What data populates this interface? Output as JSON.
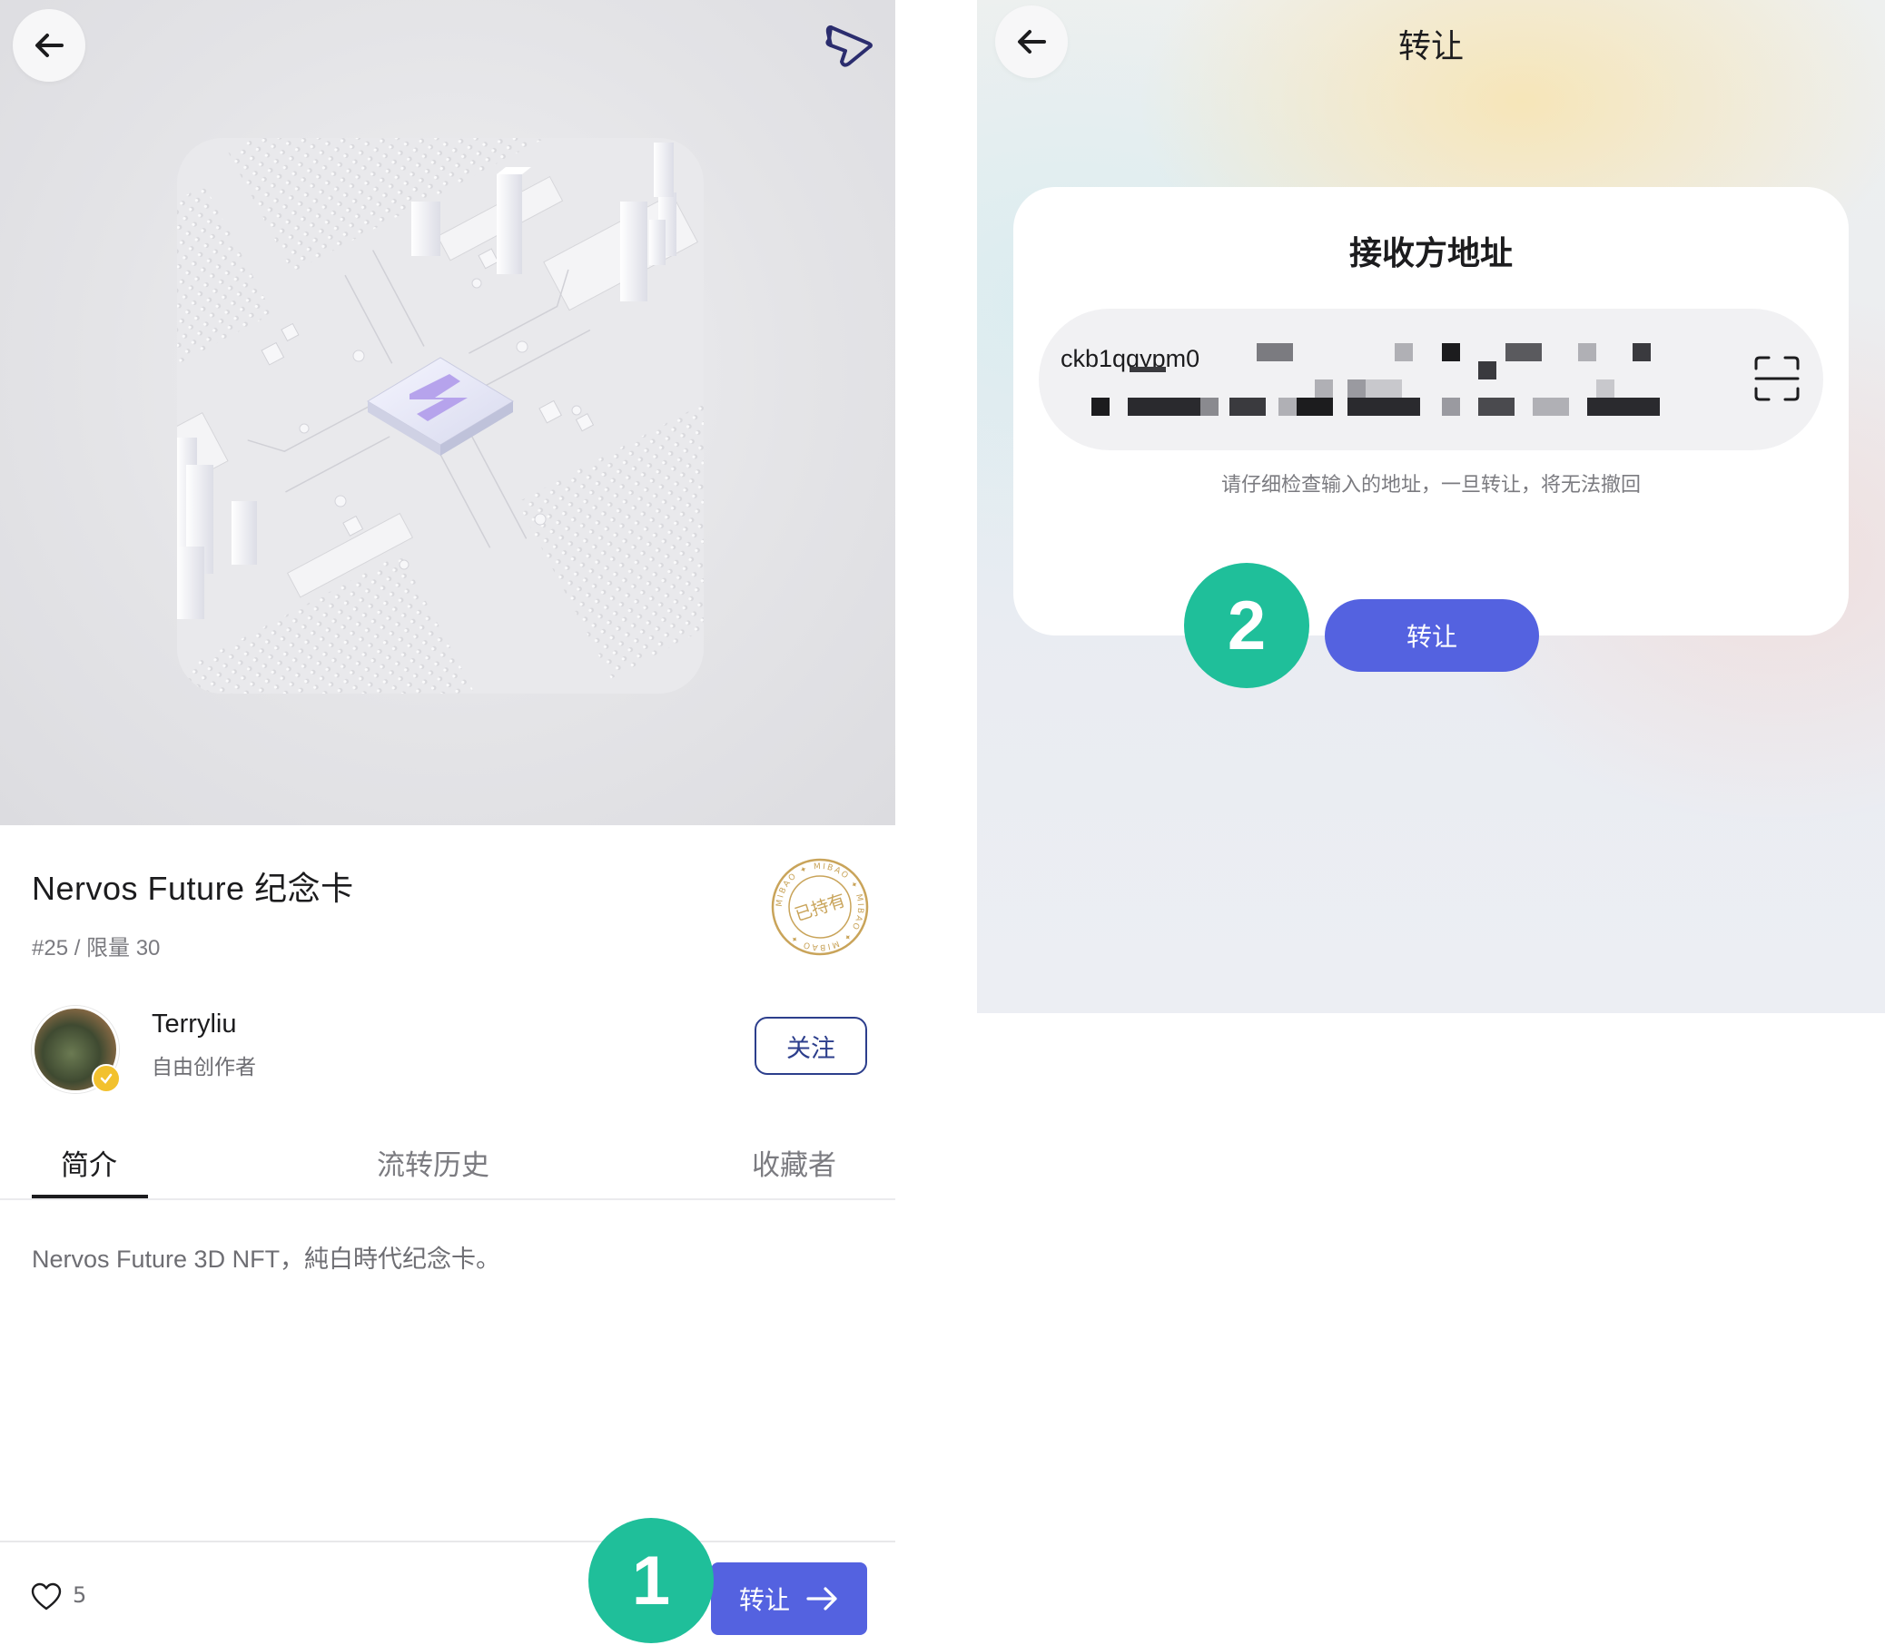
{
  "left_screen": {
    "nft": {
      "title": "Nervos Future 纪念卡",
      "edition": "#25 / 限量 30",
      "stamp_text": "已持有",
      "stamp_ring_text": "MIBAO"
    },
    "creator": {
      "name": "Terryliu",
      "role": "自由创作者",
      "follow_label": "关注"
    },
    "tabs": [
      {
        "label": "简介",
        "active": true
      },
      {
        "label": "流转历史",
        "active": false
      },
      {
        "label": "收藏者",
        "active": false
      }
    ],
    "description": "Nervos Future 3D NFT，純白時代纪念卡。",
    "bottom_bar": {
      "like_count": "5",
      "transfer_label": "转让"
    },
    "step_badge": "1"
  },
  "right_screen": {
    "title": "转让",
    "card": {
      "title": "接收方地址",
      "address_visible": "ckb1qqypm0",
      "hint": "请仔细检查输入的地址，一旦转让，将无法撤回"
    },
    "transfer_label": "转让",
    "step_badge": "2"
  },
  "colors": {
    "accent_button": "#5462e0",
    "step_badge": "#1fbf9a",
    "follow_border": "#2c3e8c",
    "stamp": "#c9a45a"
  },
  "icons": [
    "back-arrow-icon",
    "share-icon",
    "verified-badge-icon",
    "heart-icon",
    "arrow-right-icon",
    "scan-icon"
  ]
}
